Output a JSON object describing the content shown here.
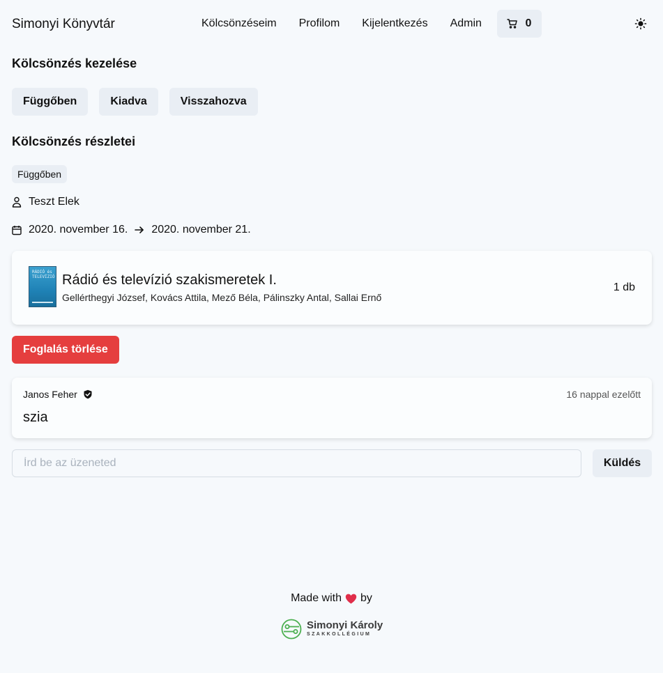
{
  "header": {
    "brand": "Simonyi Könyvtár",
    "nav": [
      "Kölcsönzéseim",
      "Profilom",
      "Kijelentkezés",
      "Admin"
    ],
    "cart_count": "0",
    "cart_icon": "cart-icon",
    "theme_icon": "sun-icon"
  },
  "manage": {
    "title": "Kölcsönzés kezelése",
    "buttons": [
      "Függőben",
      "Kiadva",
      "Visszahozva"
    ]
  },
  "details": {
    "title": "Kölcsönzés részletei",
    "status": "Függőben",
    "user": "Teszt Elek",
    "date_from": "2020. november 16.",
    "date_to": "2020. november 21."
  },
  "book": {
    "title": "Rádió és televízió szakismeretek I.",
    "authors": "Gellérthegyi József, Kovács Attila, Mező Béla, Pálinszky Antal, Sallai Ernő",
    "quantity": "1 db",
    "cover_text": "RÁDIÓ és TELEVÍZIÓ"
  },
  "actions": {
    "delete_label": "Foglalás törlése",
    "delete_color": "#e53e3e"
  },
  "comment": {
    "author": "Janos Feher",
    "time": "16 nappal ezelőtt",
    "text": "szia"
  },
  "message": {
    "placeholder": "Írd be az üzeneted",
    "send_label": "Küldés"
  },
  "footer": {
    "made_with": "Made with",
    "by": "by",
    "logo_name": "Simonyi Károly",
    "logo_sub": "SZAKKOLLÉGIUM"
  }
}
